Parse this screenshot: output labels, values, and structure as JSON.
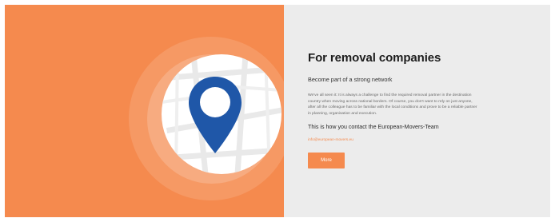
{
  "hero": {
    "icon": "location-pin-icon",
    "background_color": "#f58a4e",
    "pin_color": "#1f57a8"
  },
  "section": {
    "title": "For removal companies",
    "subtitle": "Become part of a strong network",
    "body": "We've all seen it: It is always a challenge to find the required removal partner in the destination country when moving across national borders. Of course, you don't want to rely on just anyone, after all the colleague has to be familiar with the local conditions and prove to be a reliable partner in planning, organisation and execution.",
    "contact_heading": "This is how you contact the European-Movers-Team",
    "email": "info@european-movers.eu",
    "button_label": "More",
    "accent_color": "#f58a4e"
  }
}
